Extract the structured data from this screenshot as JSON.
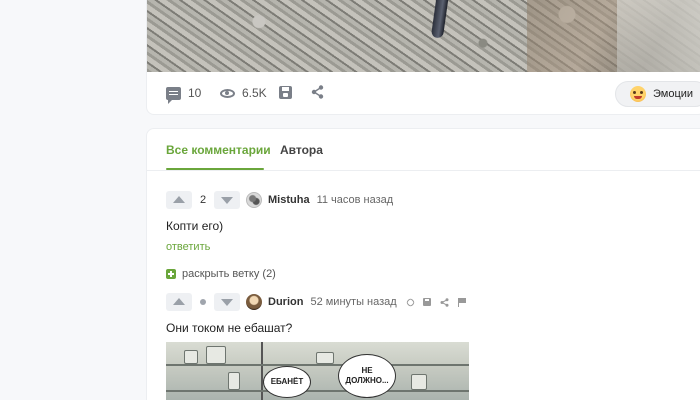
{
  "post": {
    "actions": {
      "comments_count": "10",
      "views_count": "6.5K",
      "emotions_label": "Эмоции"
    },
    "icons": [
      "comment-icon",
      "eye-icon",
      "save-icon",
      "share-icon",
      "emoji-icon"
    ]
  },
  "comments": {
    "tabs": [
      {
        "label": "Все комментарии",
        "active": true
      },
      {
        "label": "Автора",
        "active": false
      }
    ],
    "items": [
      {
        "votes": "2",
        "username": "Mistuha",
        "time": "11 часов назад",
        "text": "Копти его)",
        "reply_label": "ответить"
      },
      {
        "votes": "",
        "username": "Durion",
        "time": "52 минуты назад",
        "text": "Они током не ебашат?",
        "image_bubbles": [
          "ЕБАНЁТ",
          "НЕ ДОЛЖНО..."
        ]
      }
    ],
    "expand_thread_label": "раскрыть ветку (2)"
  },
  "colors": {
    "accent": "#6aa63b",
    "background": "#f7f8fa",
    "card": "#ffffff"
  }
}
